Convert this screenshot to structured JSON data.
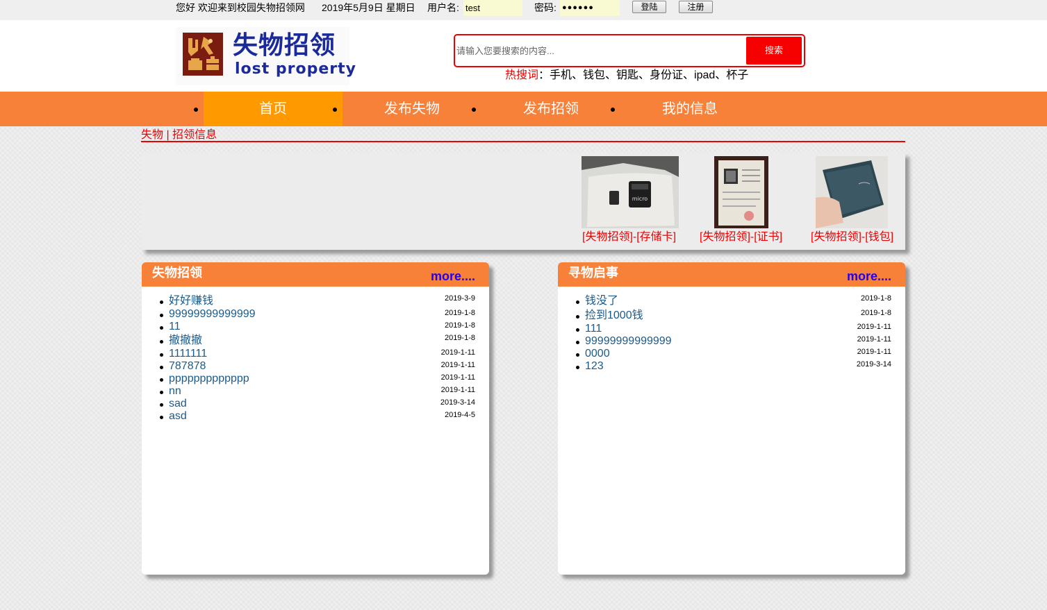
{
  "topbar": {
    "greeting": "您好 欢迎来到校园失物招领网",
    "date": "2019年5月9日 星期日",
    "username_label": "用户名:",
    "username_value": "test",
    "password_label": "密码:",
    "password_value": "●●●●●●",
    "login_button": "登陆",
    "register_button": "注册"
  },
  "logo": {
    "title_cn": "失物招领",
    "title_en": "lost property"
  },
  "search": {
    "placeholder": "请输入您要搜索的内容...",
    "button": "搜索",
    "hot_label": "热搜词",
    "hot_terms": "：手机、钱包、钥匙、身份证、ipad、杯子"
  },
  "nav": {
    "items": [
      {
        "label": "首页"
      },
      {
        "label": "发布失物"
      },
      {
        "label": "发布招领"
      },
      {
        "label": "我的信息"
      }
    ]
  },
  "section": {
    "title": "失物 | 招领信息"
  },
  "gallery": {
    "items": [
      {
        "caption": "[失物招领]-[存储卡]"
      },
      {
        "caption": "[失物招领]-[证书]"
      },
      {
        "caption": "[失物招领]-[钱包]"
      }
    ]
  },
  "lost_found": {
    "title": "失物招领",
    "more": "more....",
    "items": [
      {
        "title": "好好赚钱",
        "date": "2019-3-9"
      },
      {
        "title": "99999999999999",
        "date": "2019-1-8"
      },
      {
        "title": "11",
        "date": "2019-1-8"
      },
      {
        "title": "撤撤撤",
        "date": "2019-1-8"
      },
      {
        "title": "1111111",
        "date": "2019-1-11"
      },
      {
        "title": "787878",
        "date": "2019-1-11"
      },
      {
        "title": "ppppppppppppp",
        "date": "2019-1-11"
      },
      {
        "title": "nn",
        "date": "2019-1-11"
      },
      {
        "title": "sad",
        "date": "2019-3-14"
      },
      {
        "title": "asd",
        "date": "2019-4-5"
      }
    ]
  },
  "seek": {
    "title": "寻物启事",
    "more": "more....",
    "items": [
      {
        "title": "钱没了",
        "date": "2019-1-8"
      },
      {
        "title": "捡到1000钱",
        "date": "2019-1-8"
      },
      {
        "title": "111",
        "date": "2019-1-11"
      },
      {
        "title": "99999999999999",
        "date": "2019-1-11"
      },
      {
        "title": "0000",
        "date": "2019-1-11"
      },
      {
        "title": "123",
        "date": "2019-3-14"
      }
    ]
  }
}
